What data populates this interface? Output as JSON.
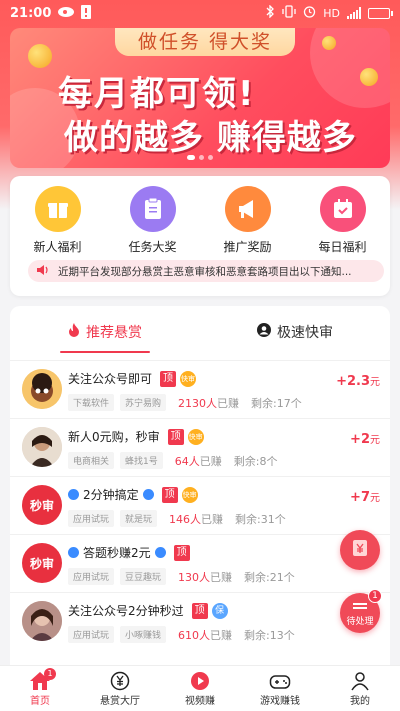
{
  "status_bar": {
    "time": "21:00",
    "network": "HD"
  },
  "banner": {
    "top_text": "做任务 得大奖",
    "line1": "每月都可领!",
    "line2": "做的越多 赚得越多"
  },
  "menu": {
    "items": [
      {
        "label": "新人福利",
        "icon": "gift-icon",
        "color": "#ffc637"
      },
      {
        "label": "任务大奖",
        "icon": "clipboard-icon",
        "color": "#9b7bf2"
      },
      {
        "label": "推广奖励",
        "icon": "megaphone-icon",
        "color": "#ff8a3d"
      },
      {
        "label": "每日福利",
        "icon": "calendar-check-icon",
        "color": "#f9507a"
      }
    ],
    "notice": "近期平台发现部分悬赏主恶意审核和恶意套路项目出以下通知..."
  },
  "tabs": [
    {
      "label": "推荐悬赏",
      "active": true
    },
    {
      "label": "极速快审",
      "active": false
    }
  ],
  "tasks": [
    {
      "title": "关注公众号即可",
      "tags": [
        "下载软件",
        "苏宁易购"
      ],
      "count": "2130人",
      "count_suffix": "已赚",
      "remain": "剩余:17个",
      "reward": "+2.3",
      "unit": "元",
      "badges": [
        "顶",
        "快审"
      ]
    },
    {
      "title": "新人0元购，秒审",
      "tags": [
        "电商相关",
        "蜂找1号"
      ],
      "count": "64人",
      "count_suffix": "已赚",
      "remain": "剩余:8个",
      "reward": "+2",
      "unit": "元",
      "badges": [
        "顶",
        "快审"
      ]
    },
    {
      "title": "2分钟搞定",
      "tags": [
        "应用试玩",
        "就是玩"
      ],
      "count": "146人",
      "count_suffix": "已赚",
      "remain": "剩余:31个",
      "reward": "+7",
      "unit": "元",
      "badges": [
        "顶",
        "快审"
      ],
      "avatar_text": "秒审"
    },
    {
      "title": "答题秒赚2元",
      "tags": [
        "应用试玩",
        "豆豆趣玩"
      ],
      "count": "130人",
      "count_suffix": "已赚",
      "remain": "剩余:21个",
      "reward": "",
      "unit": "",
      "badges": [
        "顶"
      ],
      "avatar_text": "秒审"
    },
    {
      "title": "关注公众号2分钟秒过",
      "tags": [
        "应用试玩",
        "小啄赚钱"
      ],
      "count": "610人",
      "count_suffix": "已赚",
      "remain": "剩余:13个",
      "reward": "",
      "unit": "",
      "badges": [
        "顶",
        "保"
      ]
    }
  ],
  "floating": {
    "pending_label": "待处理",
    "pending_count": "1"
  },
  "bottom_nav": [
    {
      "label": "首页",
      "icon": "home-icon",
      "active": true,
      "badge": "1"
    },
    {
      "label": "悬赏大厅",
      "icon": "yuan-coin-icon",
      "active": false
    },
    {
      "label": "视频赚",
      "icon": "play-icon",
      "active": false
    },
    {
      "label": "游戏赚钱",
      "icon": "gamepad-icon",
      "active": false
    },
    {
      "label": "我的",
      "icon": "user-icon",
      "active": false
    }
  ],
  "colors": {
    "brand": "#f0394e",
    "banner": "#ff4d5e"
  }
}
